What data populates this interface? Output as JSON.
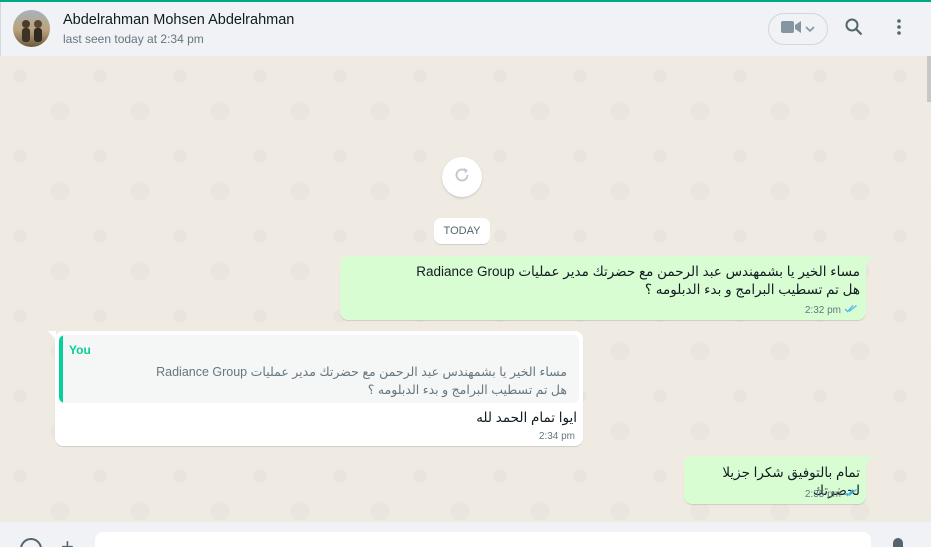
{
  "header": {
    "contact_name": "Abdelrahman Mohsen Abdelrahman",
    "status": "last seen today at 2:34 pm"
  },
  "chat": {
    "date_label": "TODAY",
    "messages": [
      {
        "direction": "outgoing",
        "text": "مساء الخير يا بشمهندس عبد الرحمن مع حضرتك  مدير عمليات Radiance Group\nهل تم تسطيب البرامج و بدء الدبلومه ؟",
        "time": "2:32 pm",
        "ticks": "read"
      },
      {
        "direction": "incoming",
        "quote_author": "You",
        "quote_text": "مساء الخير يا بشمهندس عبد الرحمن مع حضرتك  مدير عمليات Radiance Group\nهل تم تسطيب البرامج و بدء الدبلومه ؟",
        "text": "ايوا تمام الحمد لله",
        "time": "2:34 pm"
      },
      {
        "direction": "outgoing",
        "text": "تمام بالتوفيق شكرا جزيلا لحضرتك",
        "time": "2:35 pm",
        "ticks": "read"
      }
    ]
  },
  "icons": {
    "video": "video-camera-icon",
    "search": "search-icon",
    "menu": "kebab-menu-icon",
    "refresh": "refresh-icon",
    "read_ticks": "double-check-icon",
    "emoji": "emoji-icon",
    "attach": "plus-icon",
    "mic": "microphone-icon"
  },
  "colors": {
    "accent": "#00a884",
    "outgoing_bubble": "#d9fdd3",
    "incoming_bubble": "#ffffff",
    "read_ticks": "#53bdeb",
    "quote_accent": "#06cf9c"
  }
}
